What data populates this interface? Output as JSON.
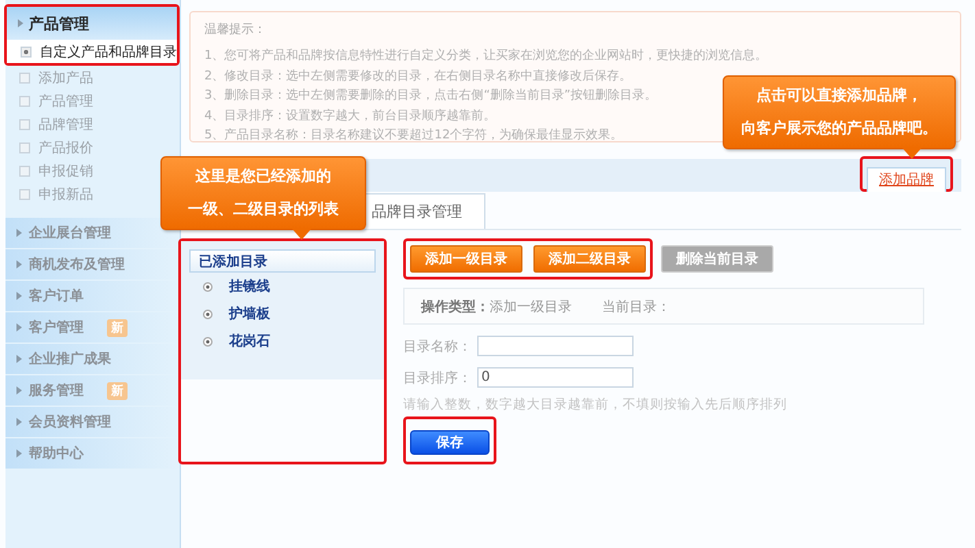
{
  "sidebar": {
    "open_section": {
      "label": "产品管理",
      "highlighted": true,
      "items": [
        {
          "label": "自定义产品和品牌目录",
          "selected": true
        },
        {
          "label": "添加产品",
          "selected": false
        },
        {
          "label": "产品管理",
          "selected": false
        },
        {
          "label": "品牌管理",
          "selected": false
        },
        {
          "label": "产品报价",
          "selected": false
        },
        {
          "label": "申报促销",
          "selected": false
        },
        {
          "label": "申报新品",
          "selected": false
        }
      ]
    },
    "sections": [
      {
        "label": "企业展台管理"
      },
      {
        "label": "商机发布及管理"
      },
      {
        "label": "客户订单"
      },
      {
        "label": "客户管理",
        "badge": "新"
      },
      {
        "label": "企业推广成果"
      },
      {
        "label": "服务管理",
        "badge": "新"
      },
      {
        "label": "会员资料管理"
      },
      {
        "label": "帮助中心"
      }
    ]
  },
  "tips": {
    "title": "温馨提示：",
    "lines": [
      "1、您可将产品和品牌按信息特性进行自定义分类，让买家在浏览您的企业网站时，更快捷的浏览信息。",
      "2、修改目录：选中左侧需要修改的目录，在右侧目录名称中直接修改后保存。",
      "3、删除目录：选中左侧需要删除的目录，点击右侧“删除当前目录”按钮删除目录。",
      "4、目录排序：设置数字越大，前台目录顺序越靠前。",
      "5、产品目录名称：目录名称建议不要超过12个字符，为确保最佳显示效果。"
    ]
  },
  "callouts": [
    {
      "lines": [
        "点击可以直接添加品牌，",
        "向客户展示您的产品品牌吧。"
      ],
      "kind": "right"
    },
    {
      "lines": [
        "这里是您已经添加的",
        "一级、二级目录的列表"
      ],
      "kind": "left"
    }
  ],
  "add_brand_link": {
    "label": "添加品牌",
    "highlighted": true
  },
  "tabs": [
    {
      "label": "品牌目录管理",
      "selected": true
    }
  ],
  "catalog": {
    "title": "已添加目录",
    "highlighted": true,
    "items": [
      "挂镜线",
      "护墙板",
      "花岗石"
    ]
  },
  "actions": {
    "highlighted": true,
    "buttons": [
      {
        "label": "添加一级目录",
        "disabled": false
      },
      {
        "label": "添加二级目录",
        "disabled": false
      },
      {
        "label": "删除当前目录",
        "disabled": true
      }
    ]
  },
  "operation": {
    "type_label": "操作类型：",
    "type_value": "添加一级目录",
    "current_label": "当前目录："
  },
  "form": {
    "fields": [
      {
        "label": "目录名称："
      },
      {
        "label": "目录排序：",
        "value": "0"
      }
    ],
    "hint": "请输入整数，数字越大目录越靠前，不填则按输入先后顺序排列"
  },
  "save_button": {
    "label": "保存",
    "highlighted": true
  }
}
